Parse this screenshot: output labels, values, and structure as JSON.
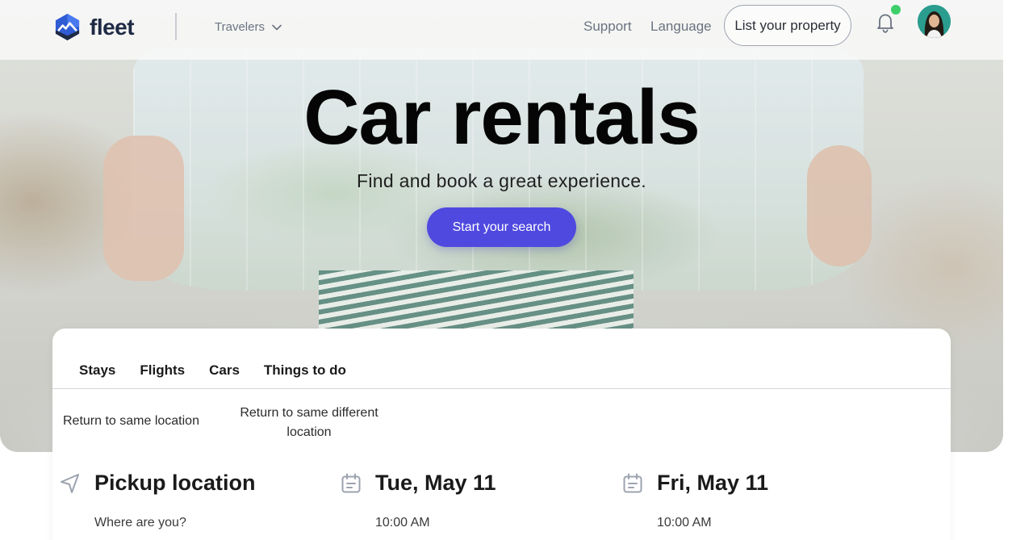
{
  "header": {
    "brand": "fleet",
    "travelers_label": "Travelers",
    "nav": {
      "support": "Support",
      "language": "Language"
    },
    "list_property_label": "List your property"
  },
  "hero": {
    "title": "Car rentals",
    "subtitle": "Find and book a great experience.",
    "cta_label": "Start your search"
  },
  "search": {
    "tabs": [
      {
        "label": "Stays"
      },
      {
        "label": "Flights"
      },
      {
        "label": "Cars"
      },
      {
        "label": "Things to do"
      }
    ],
    "return_options": {
      "same": "Return to same location",
      "different": "Return to same different location"
    },
    "pickup": {
      "label": "Pickup location",
      "placeholder": "Where are you?"
    },
    "pickup_date": {
      "label": "Tue, May 11",
      "time": "10:00 AM"
    },
    "dropoff_date": {
      "label": "Fri, May 11",
      "time": "10:00 AM"
    }
  },
  "colors": {
    "accent": "#4f49e0",
    "notification_dot": "#3ecf6b",
    "brand_dark": "#1f2a44",
    "muted_text": "#6b7280"
  },
  "icons": {
    "logo": "fleet-logo-icon",
    "travelers_dropdown": "chevron-down-icon",
    "notifications": "bell-icon",
    "pickup": "navigation-arrow-icon",
    "date": "calendar-icon"
  }
}
